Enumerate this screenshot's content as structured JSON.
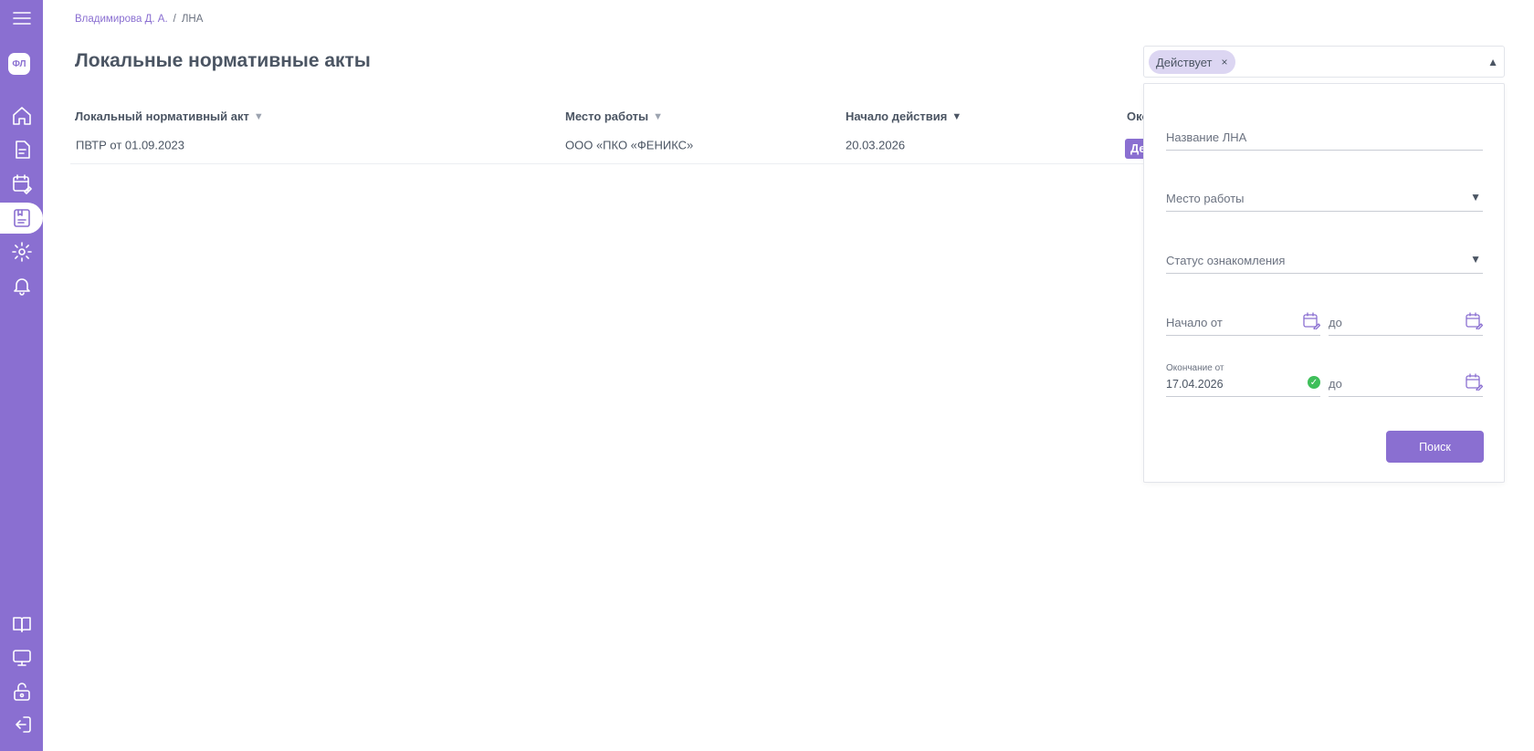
{
  "sidebar": {
    "avatar_initials": "ФЛ",
    "top_items": [
      {
        "name": "home-icon"
      },
      {
        "name": "documents-icon"
      },
      {
        "name": "calendar-edit-icon"
      },
      {
        "name": "local-acts-icon",
        "active": true
      },
      {
        "name": "settings-icon"
      },
      {
        "name": "bell-icon"
      }
    ],
    "bottom_items": [
      {
        "name": "book-icon"
      },
      {
        "name": "monitor-icon"
      },
      {
        "name": "lock-icon"
      },
      {
        "name": "logout-icon"
      }
    ],
    "accent": "#8a6fd1"
  },
  "breadcrumb": {
    "user": "Владимирова Д. А.",
    "separator": "/",
    "current": "ЛНА"
  },
  "page": {
    "title": "Локальные нормативные акты"
  },
  "table": {
    "columns": [
      {
        "label": "Локальный нормативный акт",
        "sort_active": false
      },
      {
        "label": "Место работы",
        "sort_active": false
      },
      {
        "label": "Начало действия",
        "sort_active": true
      },
      {
        "label": "Око",
        "sort_active": false
      }
    ],
    "rows": [
      {
        "act": "ПВТР от 01.09.2023",
        "workplace": "ООО «ПКО «ФЕНИКС»",
        "start": "20.03.2026",
        "status_chip": "Де"
      }
    ]
  },
  "filter": {
    "selected_tag": "Действует",
    "tag_close": "×",
    "caret": "▲",
    "fields": {
      "name_placeholder": "Название ЛНА",
      "workplace_label": "Место работы",
      "status_label": "Статус ознакомления",
      "start_from_label": "Начало от",
      "start_to_label": "до",
      "end_from_label": "Окончание от",
      "end_from_value": "17.04.2026",
      "end_to_label": "до",
      "dropdown_caret": "▼"
    },
    "search_button": "Поиск"
  }
}
